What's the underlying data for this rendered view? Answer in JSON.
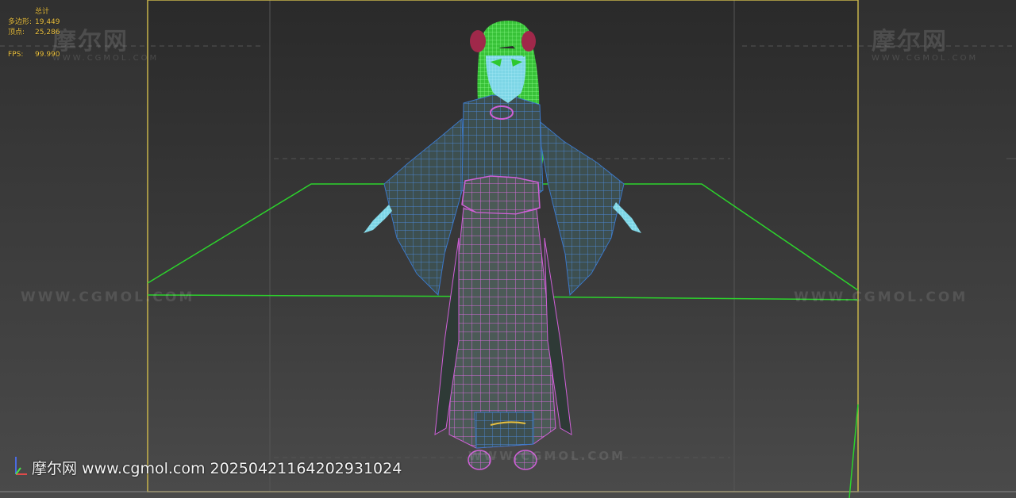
{
  "stats": {
    "title": "总计",
    "rows": [
      {
        "label": "多边形:",
        "value": "19,449"
      },
      {
        "label": "顶点:",
        "value": "25,286"
      }
    ],
    "fps_label": "FPS:",
    "fps_value": "99.990"
  },
  "watermark": {
    "logo_text": "摩尔网",
    "logo_sub": "WWW.CGMOL.COM",
    "url_text": "WWW.CGMOL.COM",
    "bottom_caption": "摩尔网 www.cgmol.com 20250421164202931024"
  },
  "colors": {
    "viewport_bg": "#3a3a3a",
    "safe_frame": "#c8b44a",
    "grid_plane": "#2cd42c",
    "hair_wire": "#4ce44c",
    "robe_wire": "#3b78c8",
    "skirt_wire": "#d060d8",
    "skin": "#7fd8e8",
    "stats_text": "#f2c744"
  },
  "icons": [
    "axis-gizmo-icon"
  ]
}
